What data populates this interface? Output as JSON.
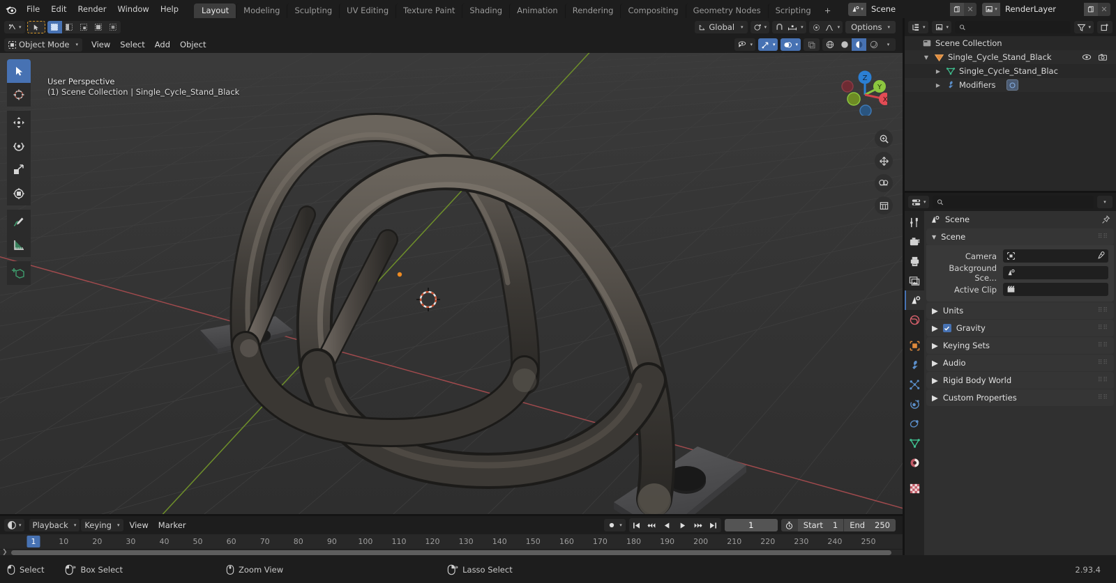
{
  "app": {
    "version": "2.93.4"
  },
  "topbar": {
    "logo_icon": "blender-logo-icon",
    "menus": [
      "File",
      "Edit",
      "Render",
      "Window",
      "Help"
    ],
    "workspaces": [
      {
        "label": "Layout",
        "active": true
      },
      {
        "label": "Modeling",
        "active": false
      },
      {
        "label": "Sculpting",
        "active": false
      },
      {
        "label": "UV Editing",
        "active": false
      },
      {
        "label": "Texture Paint",
        "active": false
      },
      {
        "label": "Shading",
        "active": false
      },
      {
        "label": "Animation",
        "active": false
      },
      {
        "label": "Rendering",
        "active": false
      },
      {
        "label": "Compositing",
        "active": false
      },
      {
        "label": "Geometry Nodes",
        "active": false
      },
      {
        "label": "Scripting",
        "active": false
      }
    ],
    "add_workspace_label": "+",
    "scene_name": "Scene",
    "viewlayer_name": "RenderLayer"
  },
  "viewport": {
    "header": {
      "editor_type_icon": "editor-type-3dview-icon",
      "mode_label": "Object Mode",
      "menus": [
        "View",
        "Select",
        "Add",
        "Object"
      ],
      "transform_orientation": "Global",
      "snap_icon": "magnet-icon",
      "proportional_icon": "proportional-edit-icon",
      "options_label": "Options",
      "select_modes": [
        "set",
        "extend",
        "subtract",
        "invert",
        "intersect"
      ]
    },
    "overlay": {
      "perspective": "User Perspective",
      "scene_info": "(1) Scene Collection | Single_Cycle_Stand_Black"
    },
    "gizmo": {
      "axis_x": "X",
      "axis_y": "Y",
      "axis_z": "Z"
    },
    "tools": [
      {
        "name": "tweak-tool",
        "active": true
      },
      {
        "name": "cursor-tool",
        "active": false
      },
      {
        "name": "move-tool",
        "active": false
      },
      {
        "name": "rotate-tool",
        "active": false
      },
      {
        "name": "scale-tool",
        "active": false
      },
      {
        "name": "transform-tool",
        "active": false
      },
      {
        "name": "annotate-tool",
        "active": false
      },
      {
        "name": "measure-tool",
        "active": false
      },
      {
        "name": "add-cube-tool",
        "active": false
      }
    ],
    "nav_buttons": [
      "zoom-icon",
      "pan-icon",
      "camera-view-icon",
      "toggle-ortho-icon"
    ],
    "shading_modes": [
      "wireframe",
      "solid",
      "material-preview",
      "rendered"
    ],
    "shading_active": "material-preview",
    "colors": {
      "grid": "#3a3a3a",
      "axis_x": "#c14f4f",
      "axis_y": "#7fa82b",
      "background": "#343434",
      "object": "#4d4944",
      "cursor_orange": "#ee8b22"
    }
  },
  "outliner": {
    "display_mode_icon": "outliner-view-layer-icon",
    "filter_icon": "filter-icon",
    "new_collection_icon": "new-collection-icon",
    "search_placeholder": "",
    "rows": [
      {
        "label": "Scene Collection",
        "icon": "collection-icon",
        "indent": 0,
        "disclosure": "",
        "eye": false,
        "camera": false
      },
      {
        "label": "Single_Cycle_Stand_Black",
        "icon": "object-mesh-icon",
        "indent": 1,
        "disclosure": "open",
        "eye": true,
        "camera": true
      },
      {
        "label": "Single_Cycle_Stand_Blac",
        "icon": "mesh-data-icon",
        "indent": 2,
        "disclosure": "closed",
        "eye": false,
        "camera": false
      },
      {
        "label": "Modifiers",
        "icon": "wrench-icon",
        "indent": 2,
        "disclosure": "closed",
        "eye": false,
        "camera": false,
        "badge": "modifier-subsurf-icon"
      }
    ]
  },
  "properties": {
    "editor_icon": "properties-editor-icon",
    "search_placeholder": "",
    "tabs": [
      {
        "name": "tool",
        "icon": "tool-icon",
        "active": false
      },
      {
        "name": "render",
        "icon": "render-camera-icon",
        "active": false
      },
      {
        "name": "output",
        "icon": "output-printer-icon",
        "active": false
      },
      {
        "name": "view-layer",
        "icon": "view-layer-images-icon",
        "active": false
      },
      {
        "name": "scene",
        "icon": "scene-cone-icon",
        "active": true
      },
      {
        "name": "world",
        "icon": "world-globe-icon",
        "active": false
      },
      {
        "name": "object",
        "icon": "object-square-icon",
        "active": false
      },
      {
        "name": "modifiers",
        "icon": "wrench-icon",
        "active": false
      },
      {
        "name": "particles",
        "icon": "particles-icon",
        "active": false
      },
      {
        "name": "physics",
        "icon": "physics-orbit-icon",
        "active": false
      },
      {
        "name": "constraints",
        "icon": "constraints-icon",
        "active": false
      },
      {
        "name": "data",
        "icon": "mesh-data-icon",
        "active": false
      },
      {
        "name": "material",
        "icon": "material-sphere-icon",
        "active": false
      },
      {
        "name": "texture",
        "icon": "texture-checker-icon",
        "active": false
      }
    ],
    "breadcrumb": "Scene",
    "panel": {
      "title": "Scene",
      "open": true,
      "fields": [
        {
          "label": "Camera",
          "icon": "camera-object-icon",
          "value": "",
          "has_eyedropper": true
        },
        {
          "label": "Background Sce...",
          "icon": "scene-cone-icon",
          "value": "",
          "has_eyedropper": false
        },
        {
          "label": "Active Clip",
          "icon": "movie-clip-icon",
          "value": "",
          "has_eyedropper": false
        }
      ]
    },
    "closed_panels": [
      {
        "label": "Units",
        "checkbox": null
      },
      {
        "label": "Gravity",
        "checkbox": true
      },
      {
        "label": "Keying Sets",
        "checkbox": null
      },
      {
        "label": "Audio",
        "checkbox": null
      },
      {
        "label": "Rigid Body World",
        "checkbox": null
      },
      {
        "label": "Custom Properties",
        "checkbox": null
      }
    ]
  },
  "timeline": {
    "editor_icon": "timeline-editor-icon",
    "menus": [
      "Playback",
      "Keying",
      "View",
      "Marker"
    ],
    "auto_key_icon": "record-dot-icon",
    "transport": [
      "jump-to-start",
      "jump-prev-keyframe",
      "play-reverse",
      "play",
      "jump-next-keyframe",
      "jump-to-end"
    ],
    "current_frame": "1",
    "use_preview_range_icon": "stopwatch-icon",
    "start_label": "Start",
    "start_value": "1",
    "end_label": "End",
    "end_value": "250",
    "ruler_ticks": [
      "10",
      "20",
      "30",
      "40",
      "50",
      "60",
      "70",
      "80",
      "90",
      "100",
      "110",
      "120",
      "130",
      "140",
      "150",
      "160",
      "170",
      "180",
      "190",
      "200",
      "210",
      "220",
      "230",
      "240",
      "250"
    ],
    "playhead_label": "1"
  },
  "statusbar": {
    "items": [
      {
        "icon": "mouse-left-icon",
        "label": "Select"
      },
      {
        "icon": "mouse-left-drag-icon",
        "label": "Box Select"
      },
      {
        "icon": "mouse-middle-icon",
        "label": "Zoom View"
      },
      {
        "icon": "mouse-right-drag-icon",
        "label": "Lasso Select"
      }
    ],
    "version": "2.93.4"
  }
}
